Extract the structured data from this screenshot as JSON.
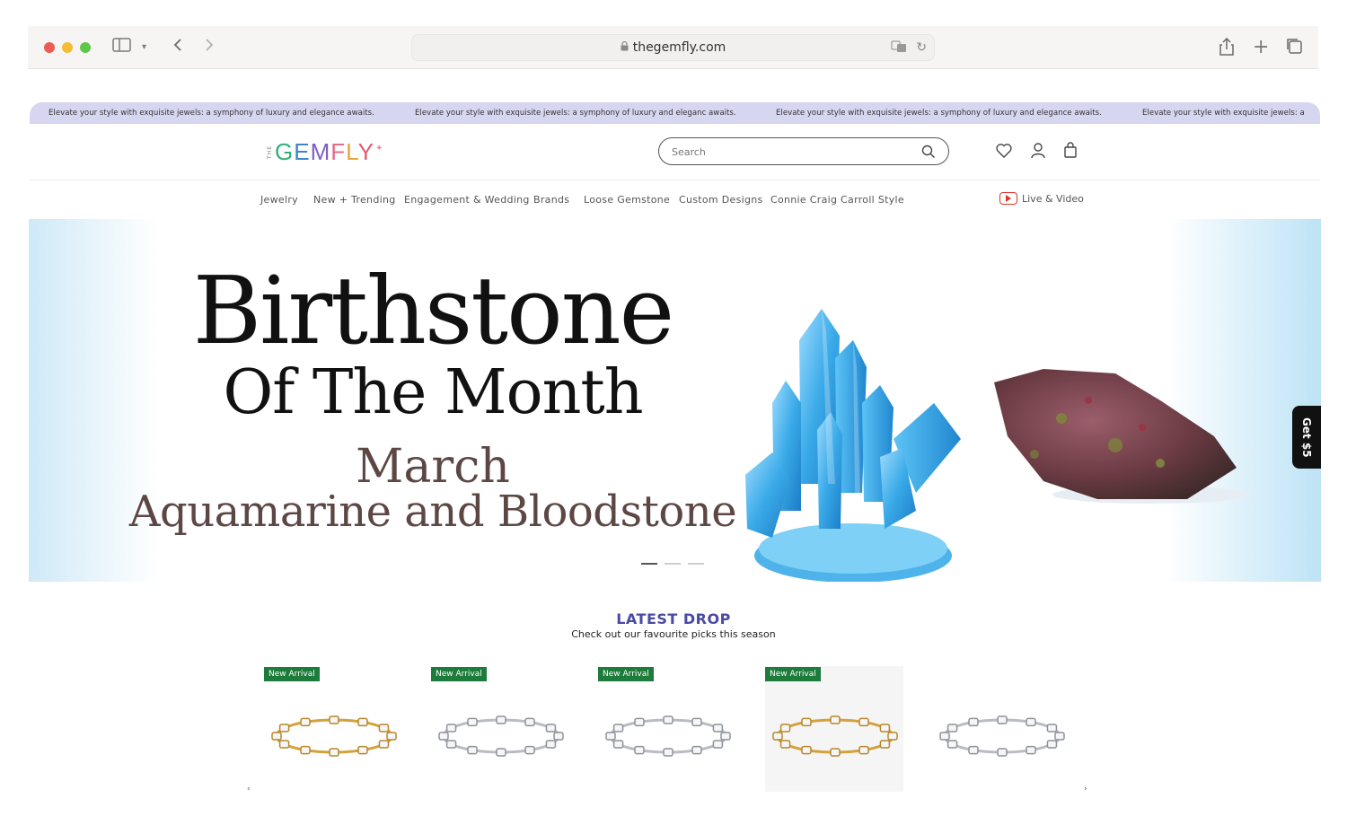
{
  "browser": {
    "url": "thegemfly.com"
  },
  "announcement": {
    "items": [
      "Elevate your style with exquisite jewels: a symphony of luxury and elegance awaits.",
      "Elevate your style with exquisite jewels: a symphony of luxury and eleganc awaits.",
      "Elevate your style with exquisite jewels: a symphony of luxury and elegance awaits.",
      "Elevate your style with exquisite jewels: a"
    ]
  },
  "header": {
    "logo_prefix": "THE",
    "logo_letters": [
      "G",
      "E",
      "M",
      "F",
      "L",
      "Y"
    ],
    "logo_colors": [
      "#31b07b",
      "#3b86c8",
      "#7b5fc0",
      "#e36c8a",
      "#e9a53a",
      "#e35a73"
    ],
    "search_placeholder": "Search"
  },
  "nav": {
    "items": [
      "Jewelry",
      "New + Trending",
      "Engagement & Wedding",
      "Brands",
      "Loose Gemstone",
      "Custom Designs",
      "Connie Craig Carroll Style"
    ],
    "live": "Live & Video"
  },
  "hero": {
    "line1": "Birthstone",
    "line2": "Of The Month",
    "line3": "March",
    "line4": "Aquamarine and Bloodstone",
    "slides": 3,
    "active_slide": 1
  },
  "side_tab": "Get $5",
  "latest": {
    "title": "LATEST DROP",
    "subtitle": "Check out our favourite picks this season",
    "products": [
      {
        "badge": "New Arrival",
        "metal": "gold",
        "shaded": false
      },
      {
        "badge": "New Arrival",
        "metal": "silver",
        "shaded": false
      },
      {
        "badge": "New Arrival",
        "metal": "silver",
        "shaded": false
      },
      {
        "badge": "New Arrival",
        "metal": "gold",
        "shaded": true
      },
      {
        "badge": "",
        "metal": "silver",
        "shaded": false
      }
    ]
  },
  "colors": {
    "announce_bg": "#d7d6f1",
    "accent": "#4a4aa3",
    "badge": "#1d7b3b",
    "hero_subtext": "#5d4744"
  }
}
